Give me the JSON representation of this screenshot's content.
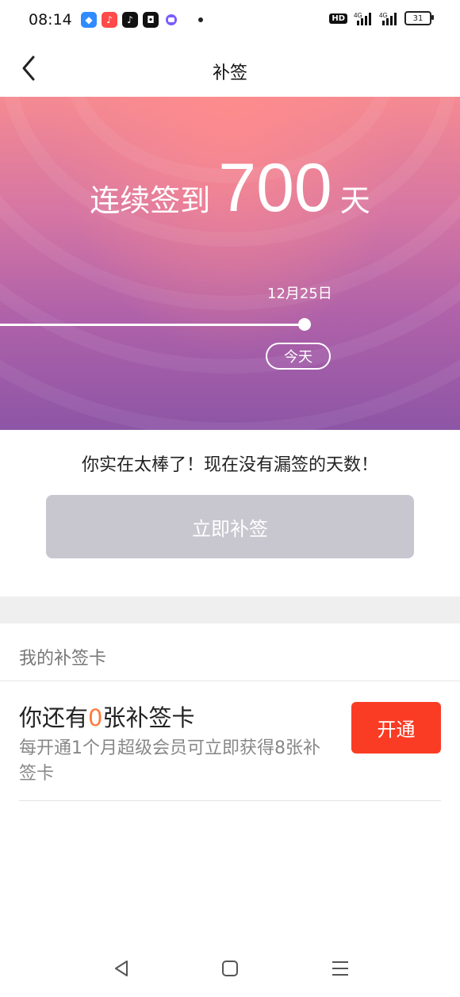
{
  "status": {
    "time": "08:14",
    "hd": "HD",
    "signal1": "4G",
    "signal2": "4G",
    "battery": "31"
  },
  "nav": {
    "title": "补签"
  },
  "hero": {
    "streak_label": "连续签到",
    "streak_days": "700",
    "streak_unit": "天",
    "date": "12月25日",
    "today": "今天"
  },
  "main": {
    "message": "你实在太棒了！现在没有漏签的天数！",
    "makeup_button": "立即补签"
  },
  "cards": {
    "section_title": "我的补签卡",
    "count_prefix": "你还有",
    "count": "0",
    "count_suffix": "张补签卡",
    "description": "每开通1个月超级会员可立即获得8张补签卡",
    "open_button": "开通"
  },
  "colors": {
    "accent": "#fa3c24",
    "count_color": "#ff7a3c",
    "disabled_button": "#c8c7d0"
  }
}
